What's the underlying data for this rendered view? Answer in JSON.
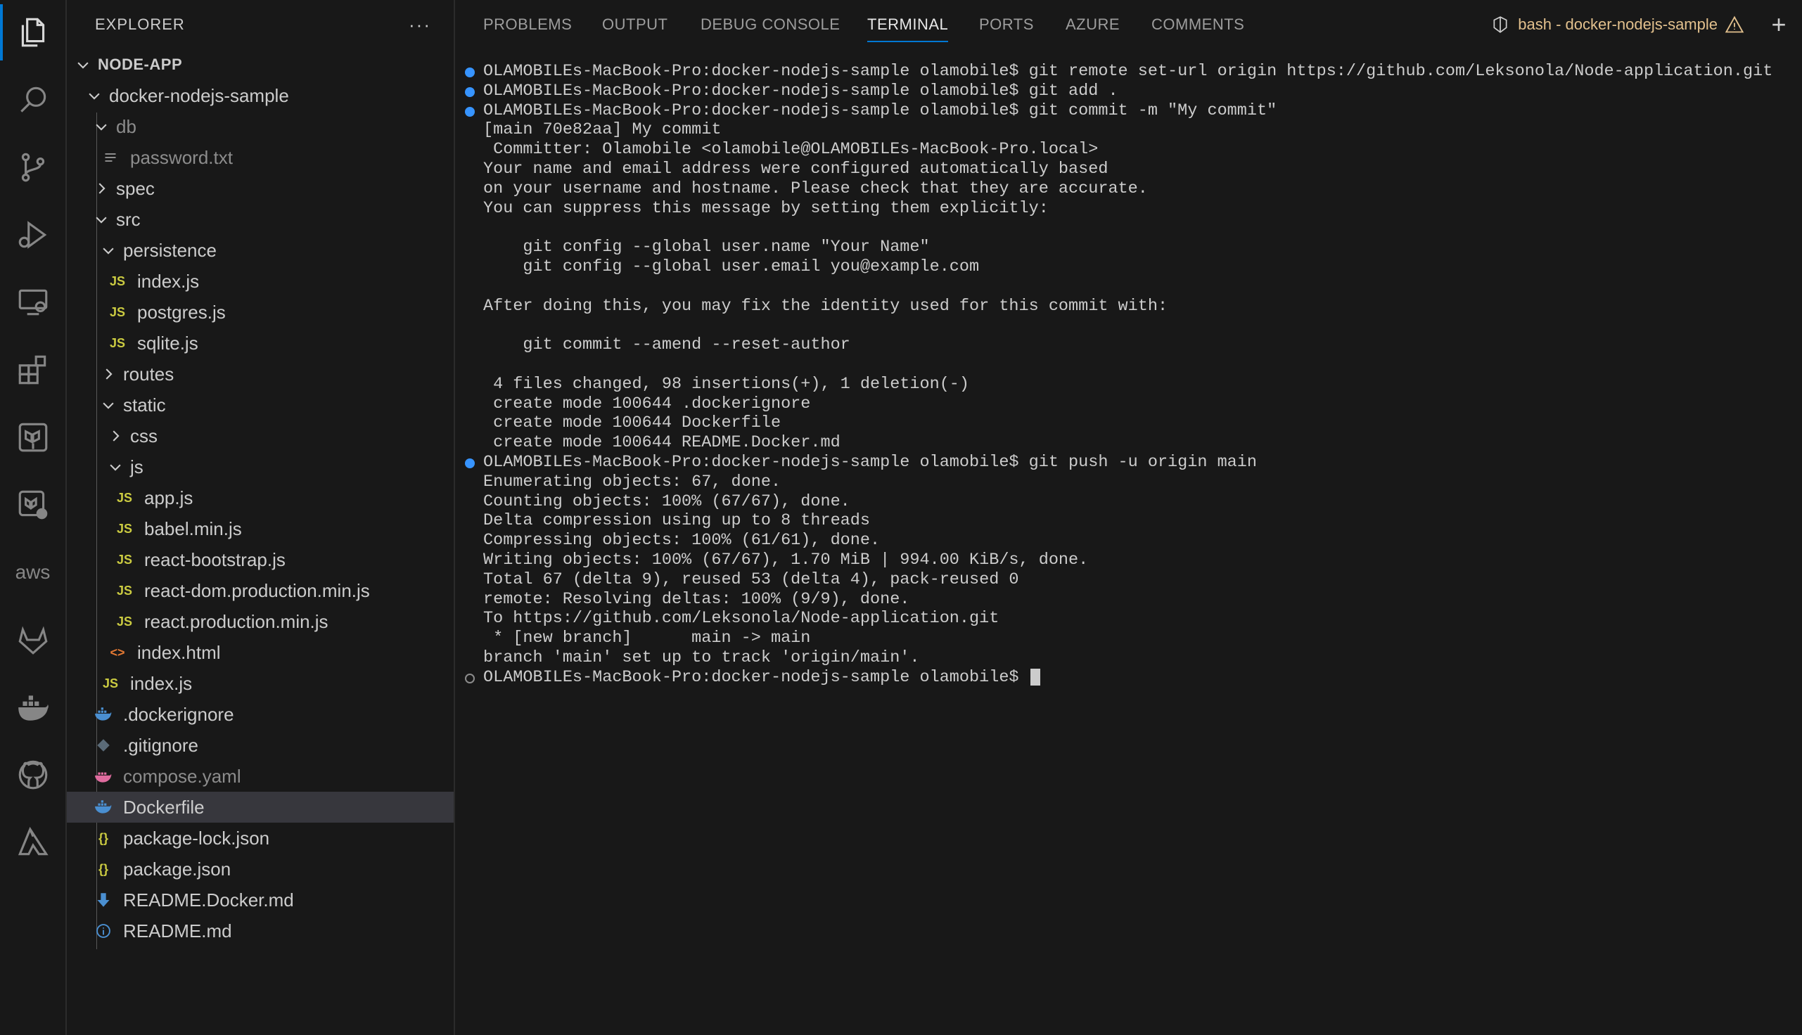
{
  "activity_bar": {
    "icons": [
      "explorer-icon",
      "search-icon",
      "source-control-icon",
      "run-debug-icon",
      "remote-explorer-icon",
      "extensions-icon",
      "terraform-icon",
      "terraform-cloud-icon",
      "aws-icon",
      "gitlab-icon",
      "docker-icon",
      "github-icon",
      "azure-icon"
    ],
    "aws_text": "aws"
  },
  "sidebar": {
    "title": "EXPLORER",
    "more": "···",
    "tree": [
      {
        "label": "NODE-APP",
        "type": "root"
      },
      {
        "label": "docker-nodejs-sample",
        "type": "folder"
      },
      {
        "label": "db",
        "type": "folder"
      },
      {
        "label": "password.txt",
        "type": "file",
        "icon": "text-file-icon"
      },
      {
        "label": "spec",
        "type": "folder"
      },
      {
        "label": "src",
        "type": "folder"
      },
      {
        "label": "persistence",
        "type": "folder"
      },
      {
        "label": "index.js",
        "type": "file",
        "icon": "JS"
      },
      {
        "label": "postgres.js",
        "type": "file",
        "icon": "JS"
      },
      {
        "label": "sqlite.js",
        "type": "file",
        "icon": "JS"
      },
      {
        "label": "routes",
        "type": "folder"
      },
      {
        "label": "static",
        "type": "folder"
      },
      {
        "label": "css",
        "type": "folder"
      },
      {
        "label": "js",
        "type": "folder"
      },
      {
        "label": "app.js",
        "type": "file",
        "icon": "JS"
      },
      {
        "label": "babel.min.js",
        "type": "file",
        "icon": "JS"
      },
      {
        "label": "react-bootstrap.js",
        "type": "file",
        "icon": "JS"
      },
      {
        "label": "react-dom.production.min.js",
        "type": "file",
        "icon": "JS"
      },
      {
        "label": "react.production.min.js",
        "type": "file",
        "icon": "JS"
      },
      {
        "label": "index.html",
        "type": "file",
        "icon": "<>"
      },
      {
        "label": "index.js",
        "type": "file",
        "icon": "JS"
      },
      {
        "label": ".dockerignore",
        "type": "file",
        "icon": "docker-file-icon"
      },
      {
        "label": ".gitignore",
        "type": "file",
        "icon": "git-file-icon"
      },
      {
        "label": "compose.yaml",
        "type": "file",
        "icon": "compose-file-icon"
      },
      {
        "label": "Dockerfile",
        "type": "file",
        "icon": "docker-file-icon"
      },
      {
        "label": "package-lock.json",
        "type": "file",
        "icon": "{}"
      },
      {
        "label": "package.json",
        "type": "file",
        "icon": "{}"
      },
      {
        "label": "README.Docker.md",
        "type": "file",
        "icon": "markdown-download-icon"
      },
      {
        "label": "README.md",
        "type": "file",
        "icon": "info-icon"
      }
    ]
  },
  "panel": {
    "tabs": [
      "PROBLEMS",
      "OUTPUT",
      "DEBUG CONSOLE",
      "TERMINAL",
      "PORTS",
      "AZURE",
      "COMMENTS"
    ],
    "active_tab": "TERMINAL",
    "terminal_title": "bash - docker-nodejs-sample",
    "add_label": "+"
  },
  "terminal": {
    "lines": [
      "OLAMOBILEs-MacBook-Pro:docker-nodejs-sample olamobile$ git remote set-url origin https://github.com/Leksonola/Node-application.git",
      "OLAMOBILEs-MacBook-Pro:docker-nodejs-sample olamobile$ git add .",
      "OLAMOBILEs-MacBook-Pro:docker-nodejs-sample olamobile$ git commit -m \"My commit\"",
      "[main 70e82aa] My commit",
      " Committer: Olamobile <olamobile@OLAMOBILEs-MacBook-Pro.local>",
      "Your name and email address were configured automatically based",
      "on your username and hostname. Please check that they are accurate.",
      "You can suppress this message by setting them explicitly:",
      "",
      "    git config --global user.name \"Your Name\"",
      "    git config --global user.email you@example.com",
      "",
      "After doing this, you may fix the identity used for this commit with:",
      "",
      "    git commit --amend --reset-author",
      "",
      " 4 files changed, 98 insertions(+), 1 deletion(-)",
      " create mode 100644 .dockerignore",
      " create mode 100644 Dockerfile",
      " create mode 100644 README.Docker.md",
      "OLAMOBILEs-MacBook-Pro:docker-nodejs-sample olamobile$ git push -u origin main",
      "Enumerating objects: 67, done.",
      "Counting objects: 100% (67/67), done.",
      "Delta compression using up to 8 threads",
      "Compressing objects: 100% (61/61), done.",
      "Writing objects: 100% (67/67), 1.70 MiB | 994.00 KiB/s, done.",
      "Total 67 (delta 9), reused 53 (delta 4), pack-reused 0",
      "remote: Resolving deltas: 100% (9/9), done.",
      "To https://github.com/Leksonola/Node-application.git",
      " * [new branch]      main -> main",
      "branch 'main' set up to track 'origin/main'.",
      "OLAMOBILEs-MacBook-Pro:docker-nodejs-sample olamobile$ "
    ],
    "command_decorations": [
      "filled",
      "filled",
      "filled",
      "",
      "",
      "",
      "",
      "",
      "",
      "",
      "",
      "",
      "",
      "",
      "",
      "",
      "",
      "",
      "",
      "",
      "filled",
      "",
      "",
      "",
      "",
      "",
      "",
      "",
      "",
      "",
      "",
      "empty"
    ],
    "colors": {
      "decoration": "#3794ff",
      "text": "#cccccc",
      "warning": "#e2c08d",
      "accent": "#0078d4"
    }
  }
}
